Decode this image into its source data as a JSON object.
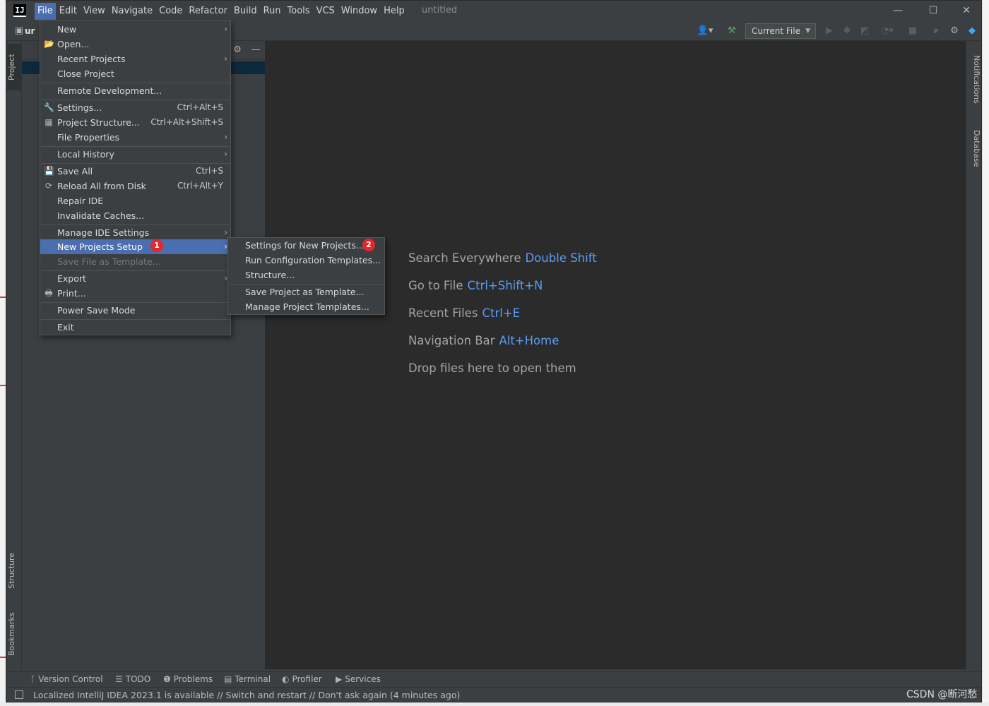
{
  "app": {
    "logo_text": "IJ",
    "project_title": "untitled",
    "project_tab_fragment": "ur"
  },
  "menubar": [
    {
      "label": "File"
    },
    {
      "label": "Edit"
    },
    {
      "label": "View"
    },
    {
      "label": "Navigate"
    },
    {
      "label": "Code"
    },
    {
      "label": "Refactor"
    },
    {
      "label": "Build"
    },
    {
      "label": "Run"
    },
    {
      "label": "Tools"
    },
    {
      "label": "VCS"
    },
    {
      "label": "Window"
    },
    {
      "label": "Help"
    }
  ],
  "window_controls": {
    "minimize": "—",
    "maximize": "☐",
    "close": "✕"
  },
  "toolbar": {
    "run_config": "Current File",
    "icons": [
      "user-icon",
      "build-hammer-icon",
      "run-icon",
      "debug-icon",
      "coverage-icon",
      "profile-icon",
      "stop-icon",
      "search-icon",
      "settings-icon",
      "plugin-icon"
    ]
  },
  "left_stripe": {
    "project": "Project",
    "structure": "Structure",
    "bookmarks": "Bookmarks"
  },
  "right_stripe": {
    "notifications": "Notifications",
    "database": "Database"
  },
  "file_menu": [
    {
      "label": "New",
      "shortcut": "",
      "submenu": true
    },
    {
      "label": "Open...",
      "shortcut": "",
      "submenu": false
    },
    {
      "label": "Recent Projects",
      "shortcut": "",
      "submenu": true
    },
    {
      "label": "Close Project",
      "shortcut": "",
      "submenu": false
    },
    {
      "label": "Remote Development...",
      "shortcut": "",
      "submenu": false
    },
    {
      "label": "Settings...",
      "shortcut": "Ctrl+Alt+S",
      "submenu": false
    },
    {
      "label": "Project Structure...",
      "shortcut": "Ctrl+Alt+Shift+S",
      "submenu": false
    },
    {
      "label": "File Properties",
      "shortcut": "",
      "submenu": true
    },
    {
      "label": "Local History",
      "shortcut": "",
      "submenu": true
    },
    {
      "label": "Save All",
      "shortcut": "Ctrl+S",
      "submenu": false
    },
    {
      "label": "Reload All from Disk",
      "shortcut": "Ctrl+Alt+Y",
      "submenu": false
    },
    {
      "label": "Repair IDE",
      "shortcut": "",
      "submenu": false
    },
    {
      "label": "Invalidate Caches...",
      "shortcut": "",
      "submenu": false
    },
    {
      "label": "Manage IDE Settings",
      "shortcut": "",
      "submenu": true
    },
    {
      "label": "New Projects Setup",
      "shortcut": "",
      "submenu": true,
      "highlighted": true
    },
    {
      "label": "Save File as Template...",
      "shortcut": "",
      "submenu": false,
      "disabled": true
    },
    {
      "label": "Export",
      "shortcut": "",
      "submenu": true
    },
    {
      "label": "Print...",
      "shortcut": "",
      "submenu": false
    },
    {
      "label": "Power Save Mode",
      "shortcut": "",
      "submenu": false
    },
    {
      "label": "Exit",
      "shortcut": "",
      "submenu": false
    }
  ],
  "sub_menu": [
    {
      "label": "Settings for New Projects..."
    },
    {
      "label": "Run Configuration Templates..."
    },
    {
      "label": "Structure..."
    },
    {
      "label": "Save Project as Template..."
    },
    {
      "label": "Manage Project Templates..."
    }
  ],
  "badges": {
    "first": "1",
    "second": "2"
  },
  "editor_hints": [
    {
      "text": "Search Everywhere",
      "key": "Double Shift"
    },
    {
      "text": "Go to File",
      "key": "Ctrl+Shift+N"
    },
    {
      "text": "Recent Files",
      "key": "Ctrl+E"
    },
    {
      "text": "Navigation Bar",
      "key": "Alt+Home"
    },
    {
      "text": "Drop files here to open them",
      "key": ""
    }
  ],
  "bottom_tools": [
    {
      "label": "Version Control",
      "icon": "branch-icon"
    },
    {
      "label": "TODO",
      "icon": "list-icon"
    },
    {
      "label": "Problems",
      "icon": "warning-icon"
    },
    {
      "label": "Terminal",
      "icon": "terminal-icon"
    },
    {
      "label": "Profiler",
      "icon": "profiler-icon"
    },
    {
      "label": "Services",
      "icon": "services-icon"
    }
  ],
  "status": {
    "message": "Localized IntelliJ IDEA 2023.1 is available // Switch and restart // Don't ask again (4 minutes ago)"
  },
  "watermark": "CSDN @断河愁",
  "colors": {
    "highlight": "#4b6eaf",
    "link": "#589df6",
    "badge": "#e5262c",
    "editor_bg": "#2b2b2b",
    "panel_bg": "#3c3f41"
  }
}
